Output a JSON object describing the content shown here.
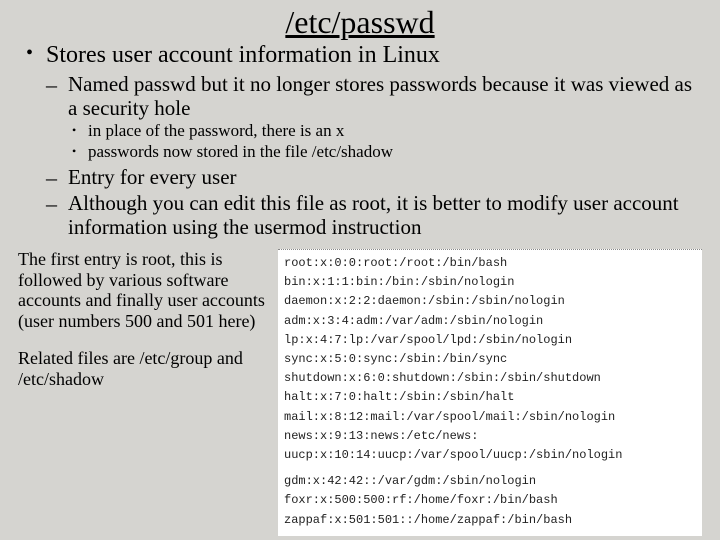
{
  "title": "/etc/passwd",
  "bullets": {
    "b1": "Stores user account information in Linux",
    "b1a": "Named passwd but it no longer stores passwords because it was viewed as a security hole",
    "b1a_i": "in place of the password, there is an x",
    "b1a_ii": "passwords now stored in the file /etc/shadow",
    "b1b": "Entry for every user",
    "b1c": "Although you can edit this file as root, it is better to modify user account information using the usermod instruction"
  },
  "note": {
    "p1": "The first entry is root, this is followed by various software accounts and finally user accounts (user numbers 500 and 501 here)",
    "p2": "Related files are /etc/group and /etc/shadow"
  },
  "passwd_lines": {
    "l0": "root:x:0:0:root:/root:/bin/bash",
    "l1": "bin:x:1:1:bin:/bin:/sbin/nologin",
    "l2": "daemon:x:2:2:daemon:/sbin:/sbin/nologin",
    "l3": "adm:x:3:4:adm:/var/adm:/sbin/nologin",
    "l4": "lp:x:4:7:lp:/var/spool/lpd:/sbin/nologin",
    "l5": "sync:x:5:0:sync:/sbin:/bin/sync",
    "l6": "shutdown:x:6:0:shutdown:/sbin:/sbin/shutdown",
    "l7": "halt:x:7:0:halt:/sbin:/sbin/halt",
    "l8": "mail:x:8:12:mail:/var/spool/mail:/sbin/nologin",
    "l9": "news:x:9:13:news:/etc/news:",
    "l10": "uucp:x:10:14:uucp:/var/spool/uucp:/sbin/nologin",
    "l11": "gdm:x:42:42::/var/gdm:/sbin/nologin",
    "l12": "foxr:x:500:500:rf:/home/foxr:/bin/bash",
    "l13": "zappaf:x:501:501::/home/zappaf:/bin/bash"
  }
}
